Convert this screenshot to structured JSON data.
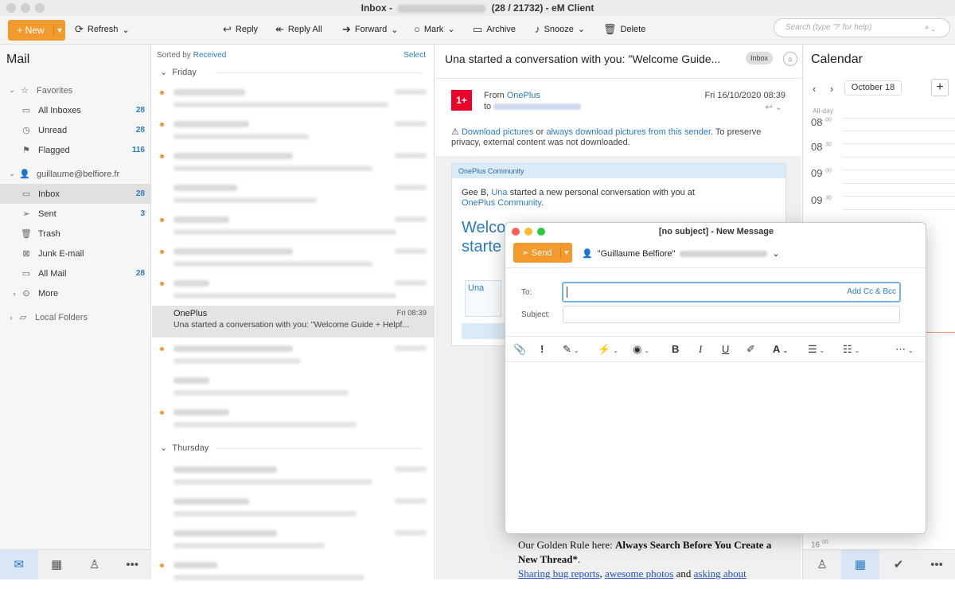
{
  "window": {
    "title_prefix": "Inbox -",
    "title_suffix": "(28 / 21732) - eM Client"
  },
  "toolbar": {
    "new_label": "New",
    "refresh_label": "Refresh",
    "reply_label": "Reply",
    "reply_all_label": "Reply All",
    "forward_label": "Forward",
    "mark_label": "Mark",
    "archive_label": "Archive",
    "snooze_label": "Snooze",
    "delete_label": "Delete",
    "search_placeholder": "Search (type '?' for help)"
  },
  "sidebar": {
    "title": "Mail",
    "favorites_label": "Favorites",
    "favorites": [
      {
        "label": "All Inboxes",
        "count": "28"
      },
      {
        "label": "Unread",
        "count": "28"
      },
      {
        "label": "Flagged",
        "count": "116"
      }
    ],
    "account": "guillaume@belfiore.fr",
    "folders": [
      {
        "label": "Inbox",
        "count": "28"
      },
      {
        "label": "Sent",
        "count": "3"
      },
      {
        "label": "Trash",
        "count": ""
      },
      {
        "label": "Junk E-mail",
        "count": ""
      },
      {
        "label": "All Mail",
        "count": "28"
      },
      {
        "label": "More",
        "count": ""
      }
    ],
    "local_folders": "Local Folders"
  },
  "message_list": {
    "sorted_by_prefix": "Sorted by",
    "sorted_by_field": "Received",
    "select_label": "Select",
    "group_friday": "Friday",
    "group_thursday": "Thursday",
    "selected": {
      "from": "OnePlus",
      "subject": "Una started a conversation with you: \"Welcome Guide + Helpf...",
      "date": "Fri 08:39"
    }
  },
  "reader": {
    "subject": "Una started a conversation with you: \"Welcome Guide...",
    "badge": "Inbox",
    "from_label": "From",
    "from_name": "OnePlus",
    "to_label": "to",
    "date": "Fri 16/10/2020 08:39",
    "notice_link1": "Download pictures",
    "notice_or": "or",
    "notice_link2": "always download pictures from this sender",
    "notice_rest": ". To preserve privacy, external content was not downloaded.",
    "card_header": "OnePlus Community",
    "greeting_prefix": "Gee B,",
    "greeting_user": "Una",
    "greeting_mid": "started a new personal conversation with you at",
    "greeting_link": "OnePlus Community",
    "greeting_end": ".",
    "welcome_line1": "Welco",
    "welcome_line2": "starte",
    "una_label": "Una",
    "golden_prefix": "Our Golden Rule here:",
    "golden_bold": "Always Search Before You Create a New Thread*",
    "golden_end": ".",
    "link1": "Sharing bug reports",
    "link2": "awesome photos",
    "and": "and",
    "link3": "asking about"
  },
  "calendar": {
    "title": "Calendar",
    "month": "October 18",
    "allday": "All-day",
    "hours": [
      {
        "h": "08",
        "m": "00"
      },
      {
        "h": "08",
        "m": "30"
      },
      {
        "h": "09",
        "m": "00"
      },
      {
        "h": "09",
        "m": "30"
      },
      {
        "h": "16",
        "m": "00"
      }
    ]
  },
  "compose": {
    "title": "[no subject] - New Message",
    "send_label": "Send",
    "sender_name": "\"Guillaume Belfiore\"",
    "to_label": "To:",
    "add_cc_label": "Add Cc & Bcc",
    "subject_label": "Subject:"
  },
  "colors": {
    "accent": "#f29a2e",
    "link": "#2a7bc4",
    "oneplus_red": "#eb0029"
  }
}
